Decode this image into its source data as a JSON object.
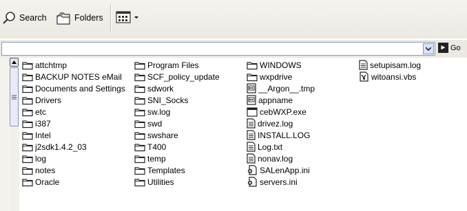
{
  "toolbar": {
    "search_label": "Search",
    "folders_label": "Folders"
  },
  "address": {
    "go_label": "Go"
  },
  "columns": [
    [
      {
        "name": "attchtmp",
        "icon": "folder"
      },
      {
        "name": "BACKUP NOTES eMail",
        "icon": "folder"
      },
      {
        "name": "Documents and Settings",
        "icon": "folder"
      },
      {
        "name": "Drivers",
        "icon": "folder"
      },
      {
        "name": "etc",
        "icon": "folder"
      },
      {
        "name": "i387",
        "icon": "folder"
      },
      {
        "name": "Intel",
        "icon": "folder"
      },
      {
        "name": "j2sdk1.4.2_03",
        "icon": "folder"
      },
      {
        "name": "log",
        "icon": "folder"
      },
      {
        "name": "notes",
        "icon": "folder"
      },
      {
        "name": "Oracle",
        "icon": "folder"
      }
    ],
    [
      {
        "name": "Program Files",
        "icon": "folder"
      },
      {
        "name": "SCF_policy_update",
        "icon": "folder"
      },
      {
        "name": "sdwork",
        "icon": "folder"
      },
      {
        "name": "SNI_Socks",
        "icon": "folder"
      },
      {
        "name": "sw.log",
        "icon": "folder"
      },
      {
        "name": "swd",
        "icon": "folder"
      },
      {
        "name": "swshare",
        "icon": "folder"
      },
      {
        "name": "T400",
        "icon": "folder"
      },
      {
        "name": "temp",
        "icon": "folder"
      },
      {
        "name": "Templates",
        "icon": "folder"
      },
      {
        "name": "Utilities",
        "icon": "folder"
      }
    ],
    [
      {
        "name": "WINDOWS",
        "icon": "folder"
      },
      {
        "name": "wxpdrive",
        "icon": "folder"
      },
      {
        "name": "__Argon__.tmp",
        "icon": "file-generic"
      },
      {
        "name": "appname",
        "icon": "file-generic"
      },
      {
        "name": "cebWXP.exe",
        "icon": "exe"
      },
      {
        "name": "drivez.log",
        "icon": "text-file"
      },
      {
        "name": "INSTALL.LOG",
        "icon": "text-file"
      },
      {
        "name": "Log.txt",
        "icon": "text-file"
      },
      {
        "name": "nonav.log",
        "icon": "text-file"
      },
      {
        "name": "SALenApp.ini",
        "icon": "settings-file"
      },
      {
        "name": "servers.ini",
        "icon": "settings-file"
      }
    ],
    [
      {
        "name": "setupisam.log",
        "icon": "text-file"
      },
      {
        "name": "witoansi.vbs",
        "icon": "script-file"
      }
    ]
  ]
}
